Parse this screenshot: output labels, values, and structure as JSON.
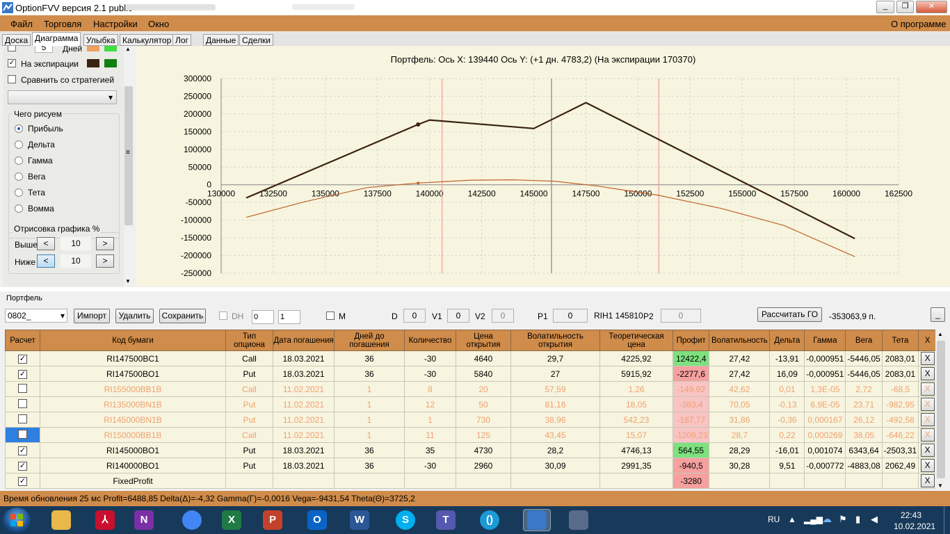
{
  "window": {
    "title": "OptionFVV версия 2.1 public",
    "controls": [
      "_",
      "❐",
      "✕"
    ]
  },
  "menu": {
    "items": [
      "Файл",
      "Торговля",
      "Настройки",
      "Окно"
    ],
    "about": "О программе"
  },
  "tabs": [
    "Доска",
    "Диаграмма",
    "Улыбка",
    "Калькулятор",
    "Лог",
    "Данные",
    "Сделки"
  ],
  "active_tab": "Диаграмма",
  "left_panel": {
    "days_label": "Дней",
    "days_value": "5",
    "expiry_label": "На экспирации",
    "expiry_checked": true,
    "compare_label": "Сравнить со стратегией",
    "compare_checked": false,
    "what_group": "Чего рисуем",
    "radios": [
      "Прибыль",
      "Дельта",
      "Гамма",
      "Вега",
      "Тета",
      "Вомма"
    ],
    "selected_radio": "Прибыль",
    "draw_group": "Отрисовка графика %",
    "above_label": "Выше",
    "above_value": "10",
    "below_label": "Ниже",
    "below_value": "10",
    "prev": "<",
    "next": ">",
    "colors": {
      "days_a": "#f0a060",
      "days_b": "#40e040",
      "exp_a": "#3a2210",
      "exp_b": "#108010"
    }
  },
  "chart_data": {
    "type": "line",
    "title": "Портфель: Ось X: 139440 Ось Y:  (+1 дн. 4783,2)  (На экспирации 170370)",
    "xlim": [
      130000,
      162500
    ],
    "ylim": [
      -250000,
      300000
    ],
    "xticks": [
      130000,
      132500,
      135000,
      137500,
      140000,
      142500,
      145000,
      147500,
      150000,
      152500,
      155000,
      157500,
      160000,
      162500
    ],
    "yticks": [
      300000,
      250000,
      200000,
      150000,
      100000,
      50000,
      0,
      -50000,
      -100000,
      -150000,
      -200000,
      -250000
    ],
    "ytick_labels": [
      "300000",
      "250000",
      "200000",
      "150000",
      "100000",
      "50000",
      "0",
      "-50000",
      "-100000",
      "-150000",
      "-200000",
      "-250000"
    ],
    "vlines": [
      {
        "x": 140600,
        "color": "#f2a0a0"
      },
      {
        "x": 145850,
        "color": "#8a8a9a"
      },
      {
        "x": 151000,
        "color": "#f2a0a0"
      }
    ],
    "series": [
      {
        "color": "#3a2210",
        "width": 2.2,
        "x": [
          131200,
          139450,
          140000,
          145000,
          147500,
          160400
        ],
        "y": [
          -37000,
          170370,
          183000,
          159000,
          232000,
          -152000
        ],
        "marker": {
          "x": 139450,
          "y": 170370
        }
      },
      {
        "color": "#c0602a",
        "width": 1.2,
        "x": [
          131200,
          134000,
          137000,
          139400,
          142000,
          144000,
          146000,
          148000,
          151000,
          154000,
          157000,
          160400
        ],
        "y": [
          -92000,
          -48000,
          -8000,
          4800,
          13000,
          14000,
          10000,
          -3000,
          -30000,
          -67000,
          -115000,
          -203000
        ],
        "marker": {
          "x": 139450,
          "y": 4783.2
        }
      }
    ],
    "grid": true
  },
  "portfolio": {
    "group_label": "Портфель",
    "account": "0802_",
    "buttons": {
      "import": "Импорт",
      "delete": "Удалить",
      "save": "Сохранить",
      "calc_go": "Рассчитать ГО",
      "min": "_"
    },
    "dh_label": "DH",
    "dh_a": "0",
    "dh_b": "1",
    "m_label": "M",
    "d_label": "D",
    "d_val": "0",
    "v1_label": "V1",
    "v1_val": "0",
    "v2_label": "V2",
    "v2_val": "0",
    "p1_label": "P1",
    "p1_val": "0",
    "instrument": "RIH1 145810",
    "p2_label": "P2",
    "p2_val": "0",
    "go_value": "-353063,9 п."
  },
  "table": {
    "headers": [
      "Расчет",
      "Код бумаги",
      "Тип опциона",
      "Дата погашения",
      "Дней до погашения",
      "Количество",
      "Цена открытия",
      "Волатильность открытия",
      "Теоретическая цена",
      "Профит",
      "Волатильность",
      "Дельта",
      "Гамма",
      "Вега",
      "Тета",
      "X"
    ],
    "rows": [
      {
        "checked": true,
        "active": true,
        "cells": [
          "RI147500BC1",
          "Call",
          "18.03.2021",
          "36",
          "-30",
          "4640",
          "29,7",
          "4225,92",
          "12422,4",
          "27,42",
          "-13,91",
          "-0,000951",
          "-5446,05",
          "2083,01"
        ],
        "profit": "pos"
      },
      {
        "checked": true,
        "active": true,
        "cells": [
          "RI147500BO1",
          "Put",
          "18.03.2021",
          "36",
          "-30",
          "5840",
          "27",
          "5915,92",
          "-2277,6",
          "27,42",
          "16,09",
          "-0,000951",
          "-5446,05",
          "2083,01"
        ],
        "profit": "neg"
      },
      {
        "checked": false,
        "active": false,
        "cells": [
          "RI155000BB1B",
          "Call",
          "11.02.2021",
          "1",
          "8",
          "20",
          "57,59",
          "1,26",
          "-149,92",
          "42,62",
          "0,01",
          "1,3E-05",
          "2,72",
          "-68,5"
        ],
        "profit": "neg"
      },
      {
        "checked": false,
        "active": false,
        "cells": [
          "RI135000BN1B",
          "Put",
          "11.02.2021",
          "1",
          "12",
          "50",
          "81,16",
          "18,05",
          "-383,4",
          "70,05",
          "-0,13",
          "6,9E-05",
          "23,71",
          "-982,95"
        ],
        "profit": "neg"
      },
      {
        "checked": false,
        "active": false,
        "cells": [
          "RI145000BN1B",
          "Put",
          "11.02.2021",
          "1",
          "1",
          "730",
          "38,96",
          "542,23",
          "-187,77",
          "31,86",
          "-0,36",
          "0,000167",
          "26,12",
          "-492,58"
        ],
        "profit": "neg"
      },
      {
        "checked": false,
        "active": false,
        "selected": true,
        "cells": [
          "RI150000BB1B",
          "Call",
          "11.02.2021",
          "1",
          "11",
          "125",
          "43,45",
          "15,07",
          "-1209,23",
          "28,7",
          "0,22",
          "0,000269",
          "38,05",
          "-646,22"
        ],
        "profit": "neg"
      },
      {
        "checked": true,
        "active": true,
        "cells": [
          "RI145000BO1",
          "Put",
          "18.03.2021",
          "36",
          "35",
          "4730",
          "28,2",
          "4746,13",
          "564,55",
          "28,29",
          "-16,01",
          "0,001074",
          "6343,64",
          "-2503,31"
        ],
        "profit": "pos"
      },
      {
        "checked": true,
        "active": true,
        "cells": [
          "RI140000BO1",
          "Put",
          "18.03.2021",
          "36",
          "-30",
          "2960",
          "30,09",
          "2991,35",
          "-940,5",
          "30,28",
          "9,51",
          "-0,000772",
          "-4883,08",
          "2062,49"
        ],
        "profit": "neg"
      },
      {
        "checked": true,
        "active": true,
        "cells": [
          "FixedProfit",
          "",
          "",
          "",
          "",
          "",
          "",
          "",
          "-3280",
          "",
          "",
          "",
          "",
          ""
        ],
        "profit": "neg"
      }
    ],
    "delete_label": "X"
  },
  "status": "Время обновления 25 мс  Profit=6488,85 Delta(Δ)=-4,32 Gamma(Γ)=-0,0016 Vega=-9431,54 Theta(Θ)=3725,2",
  "taskbar": {
    "apps": [
      {
        "name": "explorer",
        "label": "",
        "color": "#e8b84a"
      },
      {
        "name": "acrobat",
        "label": "⅄",
        "color": "#c8102e"
      },
      {
        "name": "onenote",
        "label": "N",
        "color": "#7b2fa6"
      },
      {
        "name": "chrome",
        "label": "",
        "color": "#4285f4"
      },
      {
        "name": "excel",
        "label": "X",
        "color": "#1f7a45"
      },
      {
        "name": "powerpoint",
        "label": "P",
        "color": "#c4422b"
      },
      {
        "name": "outlook",
        "label": "O",
        "color": "#0a64c8"
      },
      {
        "name": "word",
        "label": "W",
        "color": "#2b5797"
      },
      {
        "name": "skype",
        "label": "S",
        "color": "#00aff0"
      },
      {
        "name": "teams",
        "label": "T",
        "color": "#5558af"
      },
      {
        "name": "other",
        "label": "()",
        "color": "#1a9ad6"
      },
      {
        "name": "optionfvv",
        "label": "",
        "color": "#3a78c8"
      },
      {
        "name": "app2",
        "label": "",
        "color": "#5a6a8a"
      }
    ],
    "lang": "RU",
    "time": "22:43",
    "date": "10.02.2021"
  }
}
